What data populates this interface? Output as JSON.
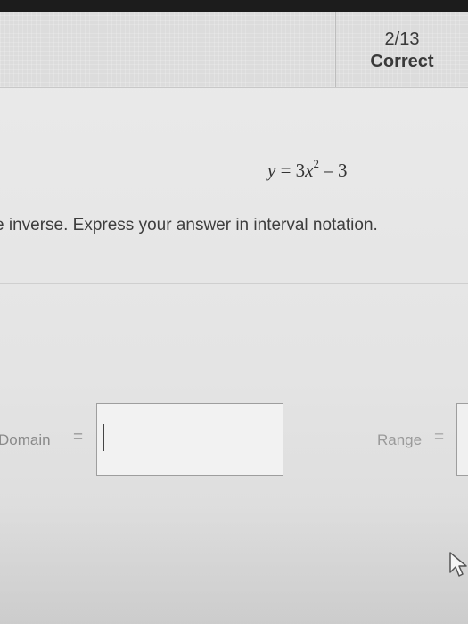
{
  "header": {
    "score_fraction": "2/13",
    "score_status": "Correct"
  },
  "problem": {
    "equation_y": "y",
    "equation_eq": " = 3",
    "equation_x": "x",
    "equation_exp": "2",
    "equation_tail": " – 3",
    "instruction": "e inverse. Express your answer in interval notation."
  },
  "answers": {
    "domain_label": "Domain",
    "domain_equals": "=",
    "domain_value": "",
    "range_label": "Range",
    "range_equals": "=",
    "range_value": ""
  },
  "icons": {
    "cursor": "mouse-pointer-icon"
  },
  "colors": {
    "page_background": "#e6e6e6",
    "header_background": "#dcdcdc",
    "bezel": "#1c1c1c",
    "input_border": "#9e9e9e"
  }
}
